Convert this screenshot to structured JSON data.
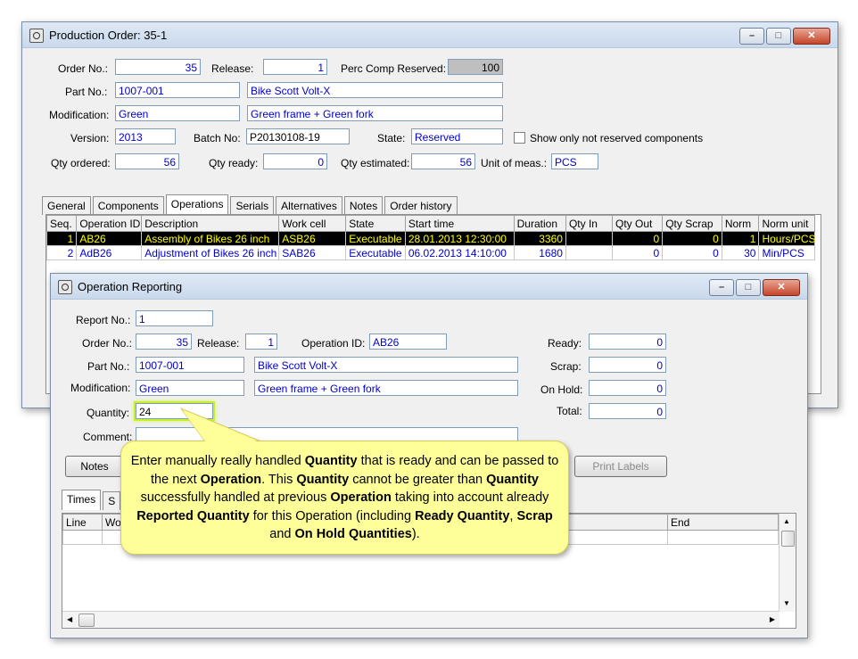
{
  "production_order": {
    "title": "Production Order: 35-1",
    "fields": {
      "order_no_label": "Order No.:",
      "order_no": "35",
      "release_label": "Release:",
      "release": "1",
      "perc_label": "Perc Comp Reserved:",
      "perc": "100",
      "part_no_label": "Part No.:",
      "part_no": "1007-001",
      "part_desc": "Bike Scott Volt-X",
      "modification_label": "Modification:",
      "modification": "Green",
      "modification_desc": "Green frame + Green fork",
      "version_label": "Version:",
      "version": "2013",
      "batch_label": "Batch No:",
      "batch": "P20130108-19",
      "state_label": "State:",
      "state": "Reserved",
      "show_label": "Show only not reserved components",
      "qty_ordered_label": "Qty ordered:",
      "qty_ordered": "56",
      "qty_ready_label": "Qty ready:",
      "qty_ready": "0",
      "qty_est_label": "Qty estimated:",
      "qty_est": "56",
      "unit_label": "Unit of meas.:",
      "unit": "PCS"
    },
    "tabs": [
      "General",
      "Components",
      "Operations",
      "Serials",
      "Alternatives",
      "Notes",
      "Order history"
    ],
    "active_tab": "Operations",
    "columns": [
      "Seq.",
      "Operation ID",
      "Description",
      "Work cell",
      "State",
      "Start time",
      "Duration",
      "Qty In",
      "Qty Out",
      "Qty Scrap",
      "Norm",
      "Norm unit"
    ],
    "rows": [
      [
        "1",
        "AB26",
        "Assembly of Bikes 26 inch",
        "ASB26",
        "Executable",
        "28.01.2013 12:30:00",
        "3360",
        "",
        "0",
        "0",
        "1",
        "Hours/PCS"
      ],
      [
        "2",
        "AdB26",
        "Adjustment of Bikes 26 inch",
        "SAB26",
        "Executable",
        "06.02.2013 14:10:00",
        "1680",
        "",
        "0",
        "0",
        "30",
        "Min/PCS"
      ]
    ]
  },
  "operation_reporting": {
    "title": "Operation Reporting",
    "fields": {
      "report_no_label": "Report No.:",
      "report_no": "1",
      "order_no_label": "Order No.:",
      "order_no": "35",
      "release_label": "Release:",
      "release": "1",
      "op_id_label": "Operation ID:",
      "op_id": "AB26",
      "ready_label": "Ready:",
      "ready": "0",
      "part_no_label": "Part No.:",
      "part_no": "1007-001",
      "part_desc": "Bike Scott Volt-X",
      "scrap_label": "Scrap:",
      "scrap": "0",
      "modification_label": "Modification:",
      "modification": "Green",
      "modification_desc": "Green frame + Green fork",
      "onhold_label": "On Hold:",
      "onhold": "0",
      "quantity_label": "Quantity:",
      "quantity": "24",
      "total_label": "Total:",
      "total": "0",
      "comment_label": "Comment:",
      "comment": ""
    },
    "buttons": {
      "notes": "Notes",
      "print_labels": "Print Labels"
    },
    "tabs": [
      "Times",
      "S"
    ],
    "columns": [
      "Line",
      "Wo",
      "tart",
      "End"
    ]
  },
  "callout": {
    "segments": [
      {
        "t": "Enter manually really handled ",
        "b": false
      },
      {
        "t": "Quantity",
        "b": true
      },
      {
        "t": " that is ready and can be passed to the next ",
        "b": false
      },
      {
        "t": "Operation",
        "b": true
      },
      {
        "t": ". This ",
        "b": false
      },
      {
        "t": "Quantity",
        "b": true
      },
      {
        "t": " cannot be greater than ",
        "b": false
      },
      {
        "t": "Quantity",
        "b": true
      },
      {
        "t": " successfully handled at previous ",
        "b": false
      },
      {
        "t": "Operation",
        "b": true
      },
      {
        "t": " taking into account already ",
        "b": false
      },
      {
        "t": "Reported Quantity",
        "b": true
      },
      {
        "t": " for this Operation (including ",
        "b": false
      },
      {
        "t": "Ready Quantity",
        "b": true
      },
      {
        "t": ", ",
        "b": false
      },
      {
        "t": "Scrap",
        "b": true
      },
      {
        "t": " and ",
        "b": false
      },
      {
        "t": "On Hold Quantities",
        "b": true
      },
      {
        "t": ").",
        "b": false
      }
    ]
  },
  "colors": {
    "field_text": "#0000cc",
    "selected_row_bg": "#000000",
    "selected_row_text": "#ffff00",
    "callout_bg": "#ffff99",
    "highlight": "#c8ef2c"
  }
}
